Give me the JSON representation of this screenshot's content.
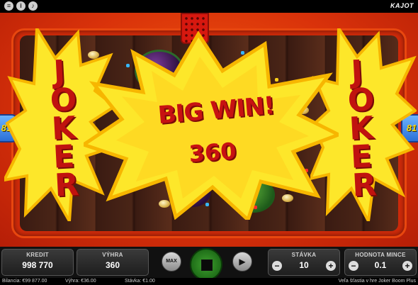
{
  "header": {
    "brand": "KAJOT",
    "icons": [
      "menu-icon",
      "info-icon",
      "sound-icon"
    ]
  },
  "game": {
    "win_title": "BIG WIN!",
    "win_amount": "360",
    "joker_left": "JOKER",
    "joker_right": "JOKER",
    "lines_left": "81",
    "lines_right": "81",
    "colors": {
      "burst": "#fde72a",
      "text": "#c71212",
      "background": "#e0400c"
    }
  },
  "controls": {
    "credit": {
      "label": "KREDIT",
      "value": "998 770"
    },
    "win": {
      "label": "VÝHRA",
      "value": "360"
    },
    "max_label": "MAX",
    "bet": {
      "label": "STÁVKA",
      "value": "10",
      "minus": "−",
      "plus": "+"
    },
    "coin_value": {
      "label": "HODNOTA MINCE",
      "value": "0.1",
      "minus": "−",
      "plus": "+"
    }
  },
  "status": {
    "balance": "Bilancia: €99 877.00",
    "win": "Výhra: €36.00",
    "bet": "Stávka: €1.00",
    "message": "Veľa šťastia v hre Joker Boom Plus"
  }
}
